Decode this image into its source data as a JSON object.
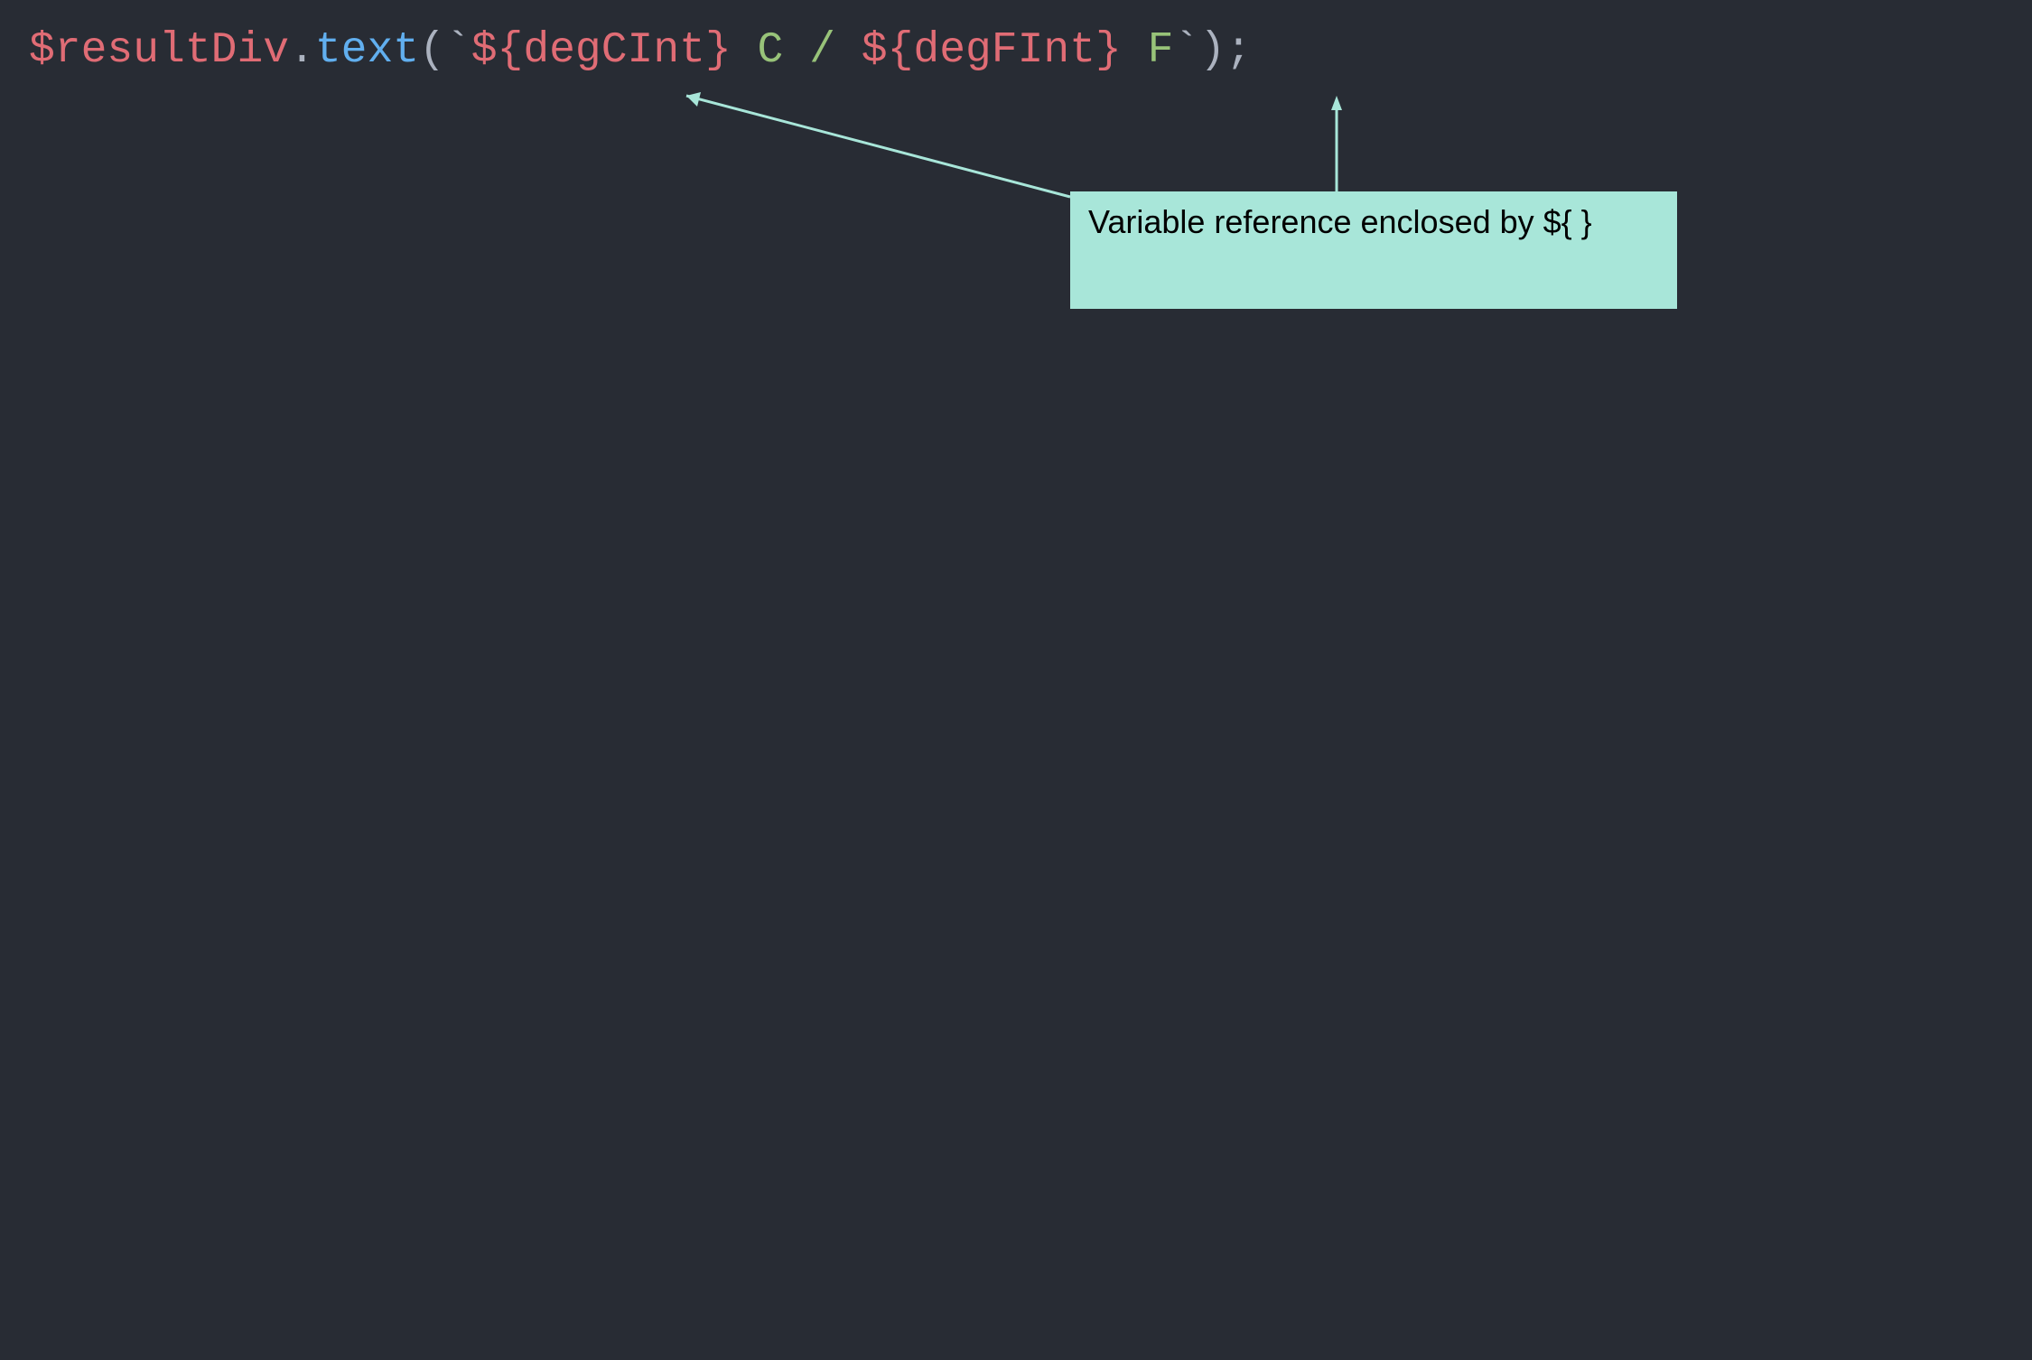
{
  "code": {
    "seg1": "$resultDiv",
    "seg2": ".",
    "seg3": "text",
    "seg4": "(",
    "seg5": "`",
    "seg6": "${degCInt}",
    "seg7": " C / ",
    "seg8": "${degFInt}",
    "seg9": " F",
    "seg10": "`",
    "seg11": ");"
  },
  "callout": {
    "text": "Variable reference enclosed by ${ }"
  }
}
